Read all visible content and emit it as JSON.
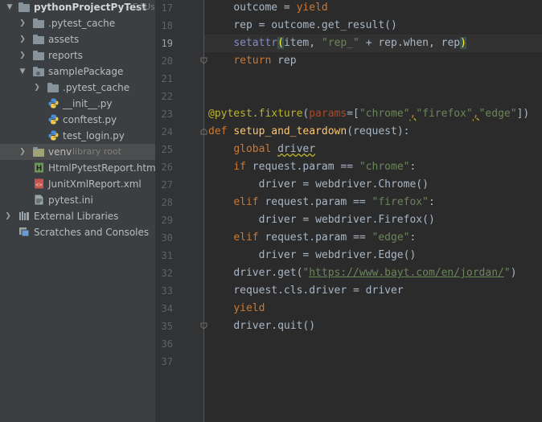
{
  "project": {
    "root_name": "pythonProjectPyTest",
    "root_path_hint": "C:\\Use",
    "items": [
      {
        "label": "pythonProjectPyTest",
        "hint": "C:\\Use",
        "icon": "folder-icon",
        "expanded": true
      },
      {
        "label": ".pytest_cache",
        "icon": "folder-icon"
      },
      {
        "label": "assets",
        "icon": "folder-icon"
      },
      {
        "label": "reports",
        "icon": "folder-icon"
      },
      {
        "label": "samplePackage",
        "icon": "package-icon",
        "expanded": true
      },
      {
        "label": ".pytest_cache",
        "icon": "folder-icon"
      },
      {
        "label": "__init__.py",
        "icon": "python-file-icon"
      },
      {
        "label": "conftest.py",
        "icon": "python-file-icon"
      },
      {
        "label": "test_login.py",
        "icon": "python-file-icon"
      },
      {
        "label": "venv",
        "hint": "library root",
        "icon": "folder-icon"
      },
      {
        "label": "HtmlPytestReport.html",
        "icon": "html-file-icon"
      },
      {
        "label": "JunitXmlReport.xml",
        "icon": "xml-file-icon"
      },
      {
        "label": "pytest.ini",
        "icon": "ini-file-icon"
      },
      {
        "label": "External Libraries",
        "icon": "libraries-icon"
      },
      {
        "label": "Scratches and Consoles",
        "icon": "scratches-icon"
      }
    ]
  },
  "editor": {
    "current_line": "19",
    "line_numbers": [
      "17",
      "18",
      "19",
      "20",
      "21",
      "22",
      "23",
      "24",
      "25",
      "26",
      "27",
      "28",
      "29",
      "30",
      "31",
      "32",
      "33",
      "34",
      "35",
      "36",
      "37"
    ],
    "code": {
      "l17": {
        "indent": "    ",
        "a": "outcome = ",
        "b": "yield"
      },
      "l18": {
        "indent": "    ",
        "a": "rep = outcome.get_result()"
      },
      "l19": {
        "indent": "    ",
        "a": "setattr",
        "b": "(",
        "c": "item, ",
        "d": "\"rep_\"",
        "e": " + rep.when, rep",
        "f": ")"
      },
      "l20": {
        "indent": "    ",
        "a": "return",
        "b": " rep"
      },
      "l23": {
        "a": "@pytest.fixture",
        "b": "(",
        "c": "params",
        "d": "=[",
        "e": "\"chrome\"",
        "f": ",",
        "g": "\"firefox\"",
        "h": ",",
        "i": "\"edge\"",
        "j": "])"
      },
      "l24": {
        "a": "def",
        "b": " ",
        "c": "setup_and_teardown",
        "d": "(request):"
      },
      "l25": {
        "indent": "    ",
        "a": "global",
        "b": " ",
        "c": "driver"
      },
      "l26": {
        "indent": "    ",
        "a": "if",
        "b": " request.param == ",
        "c": "\"chrome\"",
        "d": ":"
      },
      "l27": {
        "indent": "        ",
        "a": "driver = webdriver.Chrome()"
      },
      "l28": {
        "indent": "    ",
        "a": "elif",
        "b": " request.param == ",
        "c": "\"firefox\"",
        "d": ":"
      },
      "l29": {
        "indent": "        ",
        "a": "driver = webdriver.Firefox()"
      },
      "l30": {
        "indent": "    ",
        "a": "elif",
        "b": " request.param == ",
        "c": "\"edge\"",
        "d": ":"
      },
      "l31": {
        "indent": "        ",
        "a": "driver = webdriver.Edge()"
      },
      "l32": {
        "indent": "    ",
        "a": "driver.get(",
        "b": "\"",
        "c": "https://www.bayt.com/en/jordan/",
        "d": "\"",
        "e": ")"
      },
      "l33": {
        "indent": "    ",
        "a": "request.cls.driver = driver"
      },
      "l34": {
        "indent": "    ",
        "a": "yield"
      },
      "l35": {
        "indent": "    ",
        "a": "driver.quit()"
      }
    }
  }
}
